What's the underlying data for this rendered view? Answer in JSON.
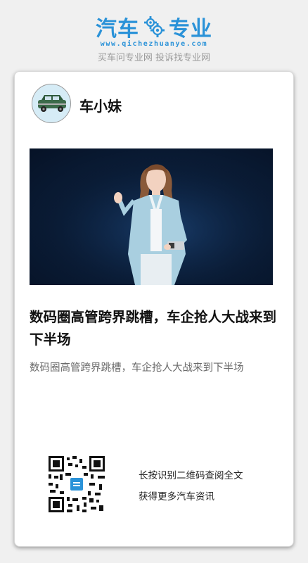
{
  "header": {
    "logo_left": "汽车",
    "logo_right": "专业",
    "url": "www.qichezhuanye.com",
    "slogan": "买车问专业网 投诉找专业网",
    "brand_color": "#2a92d8"
  },
  "post": {
    "author": "车小妹",
    "title": "数码圈高管跨界跳槽，车企抢人大战来到下半场",
    "summary": "数码圈高管跨界跳槽，车企抢人大战来到下半场"
  },
  "footer": {
    "qr_hint": "长按识别二维码查阅全文",
    "qr_sub": "获得更多汽车资讯"
  },
  "icons": {
    "gear": "gear-icon",
    "avatar": "car-avatar-icon",
    "qr": "qr-code-icon"
  }
}
